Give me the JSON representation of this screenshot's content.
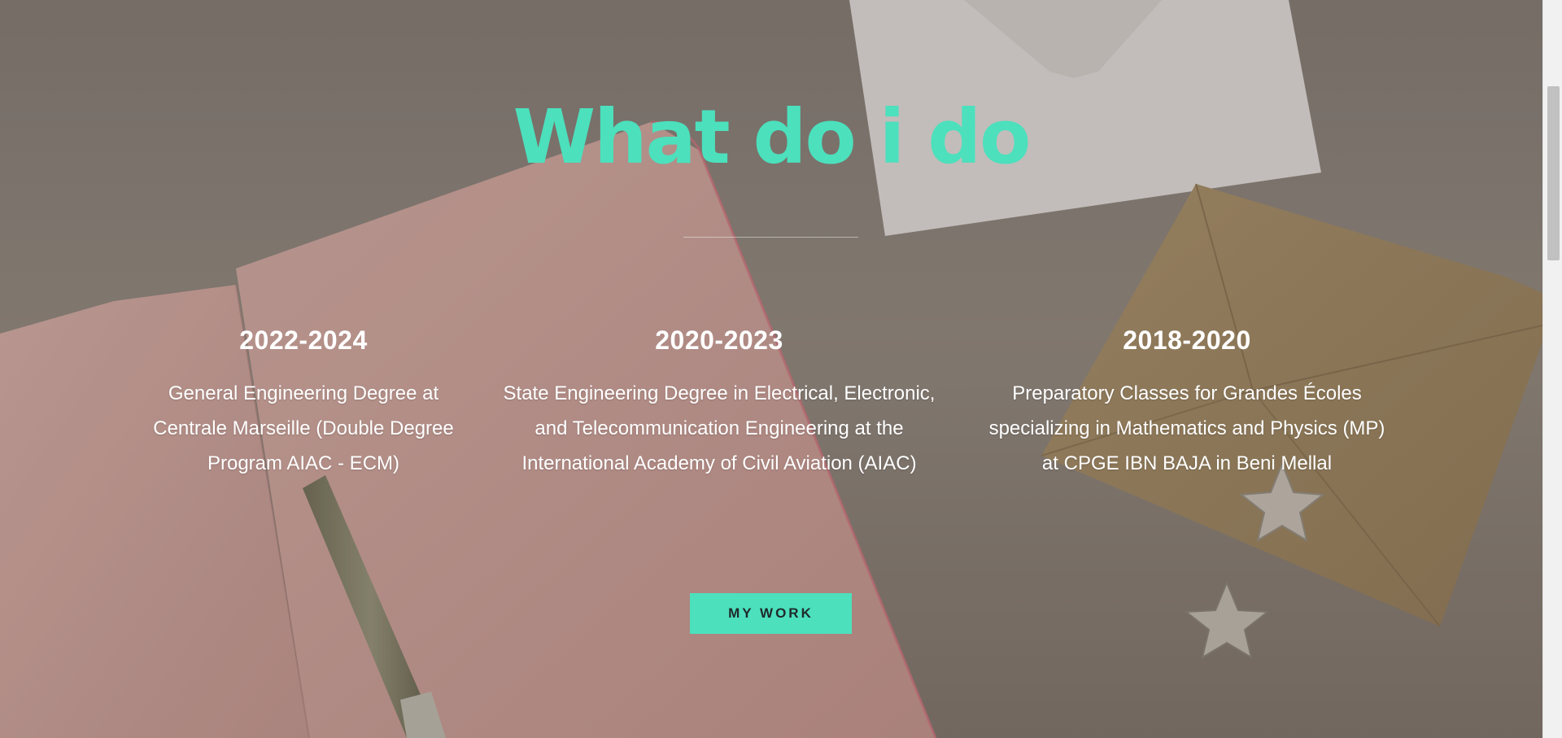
{
  "section": {
    "title": "What do i do",
    "accent_color": "#4ce0bd"
  },
  "timeline": [
    {
      "years": "2022-2024",
      "description": "General Engineering Degree at Centrale Marseille (Double Degree Program AIAC - ECM)"
    },
    {
      "years": "2020-2023",
      "description": "State Engineering Degree in Electrical, Electronic, and Telecommunication Engineering at the International Academy of Civil Aviation (AIAC)"
    },
    {
      "years": "2018-2020",
      "description": "Preparatory Classes for Grandes Écoles specializing in Mathematics and Physics (MP) at CPGE IBN BAJA in Beni Mellal"
    }
  ],
  "cta": {
    "label": "MY WORK"
  }
}
